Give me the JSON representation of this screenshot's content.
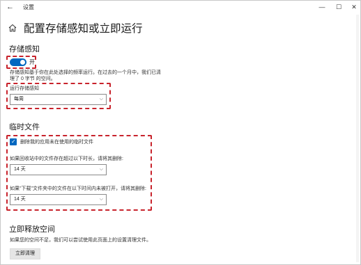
{
  "window": {
    "app_title": "设置",
    "back_glyph": "←",
    "minimize_glyph": "—",
    "maximize_glyph": "☐",
    "close_glyph": "✕"
  },
  "page": {
    "title": "配置存储感知或立即运行"
  },
  "storage_sense": {
    "heading": "存储感知",
    "toggle_state": "on",
    "toggle_label": "开",
    "description_line1": "存储感知基于你在此处选择的频率运行。在过去的一个月中，我们已清",
    "description_line2": "理了 0 字节 的空间。",
    "run_label": "运行存储感知",
    "run_value": "每周"
  },
  "temp_files": {
    "heading": "临时文件",
    "checkbox_label": "删除我的应用未在使用的临时文件",
    "checkbox_checked": true,
    "recycle_label": "如果回收站中的文件存在超过以下时长，请将其删除:",
    "recycle_value": "14 天",
    "downloads_label": "如果\"下载\"文件夹中的文件在以下时间内未被打开，请将其删除:",
    "downloads_value": "14 天"
  },
  "free_space": {
    "heading": "立即释放空间",
    "description": "如果您的空间不足，我们可以尝试使用此页面上的设置清理文件。",
    "button_label": "立即清理"
  },
  "colors": {
    "accent": "#0067c0",
    "highlight_border": "#c8232c"
  }
}
